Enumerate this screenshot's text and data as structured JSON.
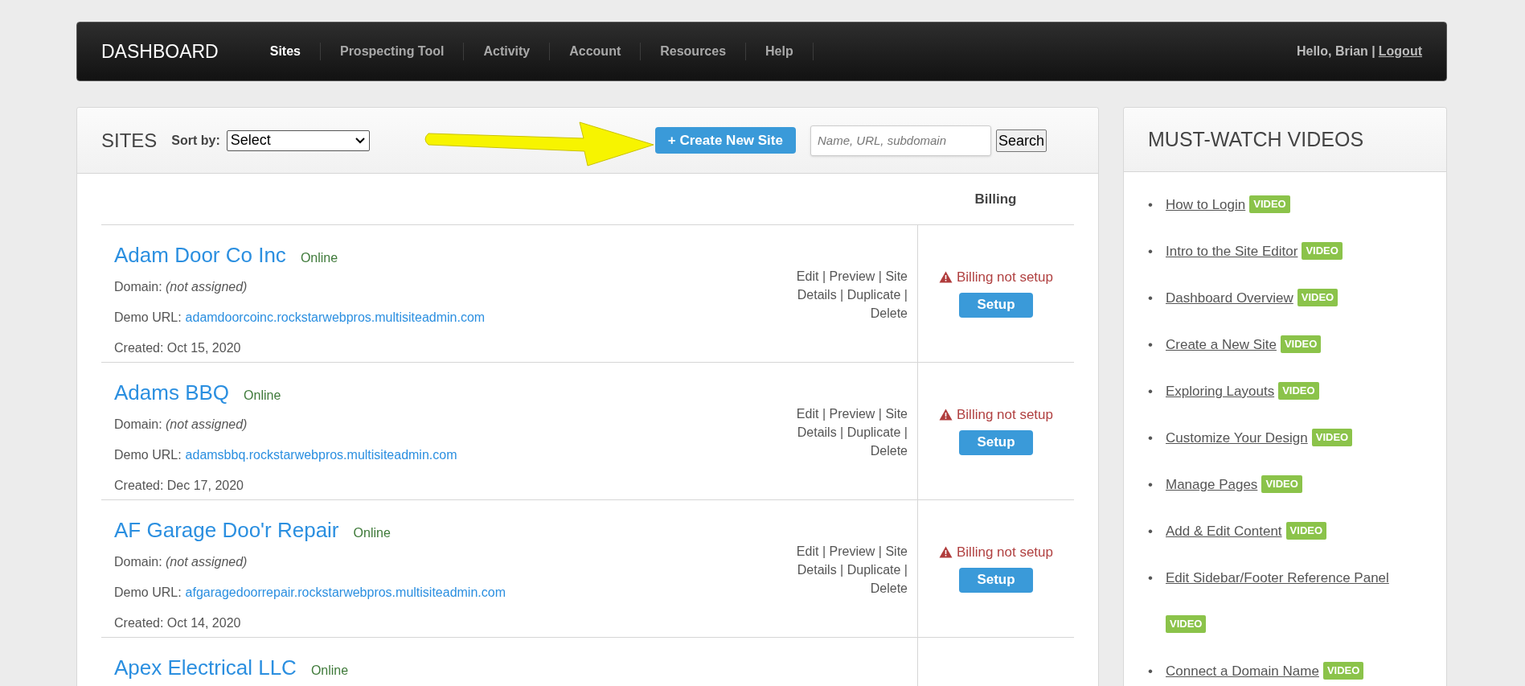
{
  "nav": {
    "brand": "DASHBOARD",
    "items": [
      {
        "label": "Sites",
        "selected": true
      },
      {
        "label": "Prospecting Tool",
        "selected": false
      },
      {
        "label": "Activity",
        "selected": false
      },
      {
        "label": "Account",
        "selected": false
      },
      {
        "label": "Resources",
        "selected": false
      },
      {
        "label": "Help",
        "selected": false
      }
    ],
    "greeting": "Hello, Brian |",
    "logout": "Logout"
  },
  "sites": {
    "title": "SITES",
    "sort_label": "Sort by:",
    "sort_value": "Select",
    "create_button": "+ Create New Site",
    "search": {
      "placeholder": "Name, URL, subdomain"
    },
    "search_button": "Search",
    "billing_heading": "Billing",
    "rows": [
      {
        "name": "Adam Door Co Inc",
        "status": "Online",
        "domain_label": "Domain:",
        "domain": "(not assigned)",
        "demo_label": "Demo URL:",
        "demo_url": "adamdoorcoinc.rockstarwebpros.multisiteadmin.com",
        "created": "Created: Oct 15, 2020",
        "actions": "Edit | Preview | Site Details | Duplicate | Delete",
        "billing_status": "Billing not setup",
        "billing_button": "Setup"
      },
      {
        "name": "Adams BBQ",
        "status": "Online",
        "domain_label": "Domain:",
        "domain": "(not assigned)",
        "demo_label": "Demo URL:",
        "demo_url": "adamsbbq.rockstarwebpros.multisiteadmin.com",
        "created": "Created: Dec 17, 2020",
        "actions": "Edit | Preview | Site Details | Duplicate | Delete",
        "billing_status": "Billing not setup",
        "billing_button": "Setup"
      },
      {
        "name": "AF Garage Doo'r Repair",
        "status": "Online",
        "domain_label": "Domain:",
        "domain": "(not assigned)",
        "demo_label": "Demo URL:",
        "demo_url": "afgaragedoorrepair.rockstarwebpros.multisiteadmin.com",
        "created": "Created: Oct 14, 2020",
        "actions": "Edit | Preview | Site Details | Duplicate | Delete",
        "billing_status": "Billing not setup",
        "billing_button": "Setup"
      },
      {
        "name": "Apex Electrical LLC",
        "status": "Online"
      }
    ]
  },
  "videos": {
    "title": "MUST-WATCH VIDEOS",
    "items": [
      {
        "bullet": "•",
        "title": "How to Login",
        "badge": "VIDEO"
      },
      {
        "bullet": "•",
        "title": "Intro to the Site Editor",
        "badge": "VIDEO"
      },
      {
        "bullet": "•",
        "title": "Dashboard Overview",
        "badge": "VIDEO"
      },
      {
        "bullet": "•",
        "title": "Create a New Site",
        "badge": "VIDEO"
      },
      {
        "bullet": "•",
        "title": "Exploring Layouts",
        "badge": "VIDEO"
      },
      {
        "bullet": "•",
        "title": "Customize Your Design",
        "badge": "VIDEO"
      },
      {
        "bullet": "•",
        "title": "Manage Pages",
        "badge": "VIDEO"
      },
      {
        "bullet": "•",
        "title": "Add & Edit Content",
        "badge": "VIDEO"
      },
      {
        "bullet": "•",
        "title": "Edit Sidebar/Footer Reference Panel",
        "badge": "VIDEO"
      },
      {
        "bullet": "•",
        "title": "Connect a Domain Name",
        "badge": "VIDEO"
      }
    ]
  }
}
